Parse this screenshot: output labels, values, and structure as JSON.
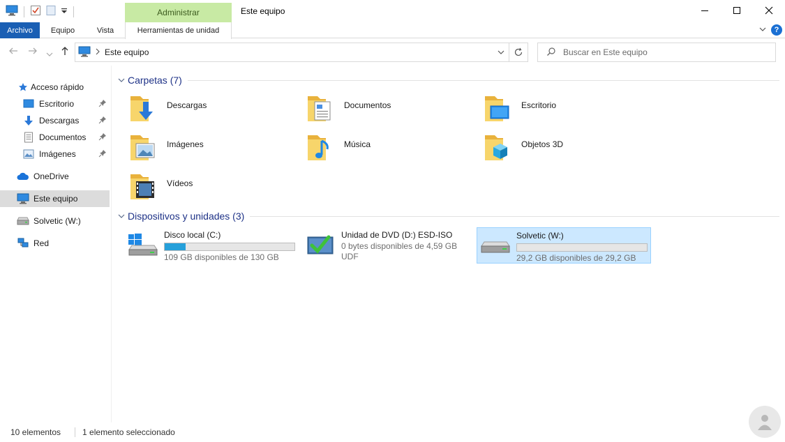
{
  "titlebar": {
    "context_tab": "Administrar",
    "window_title": "Este equipo"
  },
  "ribbon": {
    "file": "Archivo",
    "equipo": "Equipo",
    "vista": "Vista",
    "tools": "Herramientas de unidad",
    "help": "?"
  },
  "address": {
    "location": "Este equipo",
    "search_placeholder": "Buscar en Este equipo"
  },
  "nav": {
    "quick_access": "Acceso rápido",
    "escritorio": "Escritorio",
    "descargas": "Descargas",
    "documentos": "Documentos",
    "imagenes": "Imágenes",
    "onedrive": "OneDrive",
    "este_equipo": "Este equipo",
    "solvetic": "Solvetic (W:)",
    "red": "Red"
  },
  "folders_group": {
    "title": "Carpetas (7)",
    "items": [
      "Descargas",
      "Documentos",
      "Escritorio",
      "Imágenes",
      "Música",
      "Objetos 3D",
      "Vídeos"
    ]
  },
  "devices_group": {
    "title": "Dispositivos y unidades (3)",
    "drives": [
      {
        "name": "Disco local (C:)",
        "line1": "109 GB disponibles de 130 GB",
        "used_fraction": 0.16
      },
      {
        "name": "Unidad de DVD (D:) ESD-ISO",
        "line1": "0 bytes disponibles de 4,59 GB",
        "line2": "UDF"
      },
      {
        "name": "Solvetic (W:)",
        "line1": "29,2 GB disponibles de 29,2 GB",
        "used_fraction": 0.0
      }
    ]
  },
  "status": {
    "count": "10 elementos",
    "selected": "1 elemento seleccionado"
  },
  "colors": {
    "accent": "#1a5fb4",
    "context_tab": "#c8eaa4",
    "selection": "#cce8ff",
    "group_title": "#1e3287",
    "folder": "#f5c84c"
  }
}
